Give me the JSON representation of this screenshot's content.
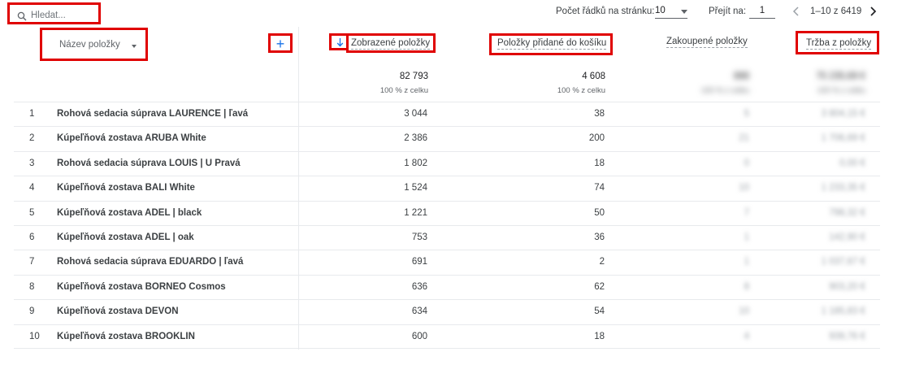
{
  "search": {
    "placeholder": "Hledat..."
  },
  "pager": {
    "rows_label": "Počet řádků na stránku:",
    "rows_value": "10",
    "goto_label": "Přejít na:",
    "goto_value": "1",
    "range": "1–10 z 6419"
  },
  "columns": {
    "dimension": "Název položky",
    "views": "Zobrazené položky",
    "cart": "Položky přidané do košíku",
    "purchased": "Zakoupené položky",
    "revenue": "Tržba z položky"
  },
  "totals": {
    "views": "82 793",
    "views_pct": "100 % z celku",
    "cart": "4 608",
    "cart_pct": "100 % z celku",
    "purchased": "888",
    "purchased_pct": "100 % z celku",
    "revenue": "75 235,69 €",
    "revenue_pct": "100 % z celku"
  },
  "rows": [
    {
      "idx": "1",
      "name": "Rohová sedacia súprava LAURENCE | ľavá",
      "views": "3 044",
      "cart": "38",
      "purchased": "5",
      "revenue": "3 804,15 €"
    },
    {
      "idx": "2",
      "name": "Kúpeľňová zostava ARUBA White",
      "views": "2 386",
      "cart": "200",
      "purchased": "21",
      "revenue": "1 706,69 €"
    },
    {
      "idx": "3",
      "name": "Rohová sedacia súprava LOUIS | U Pravá",
      "views": "1 802",
      "cart": "18",
      "purchased": "0",
      "revenue": "0,00 €"
    },
    {
      "idx": "4",
      "name": "Kúpeľňová zostava BALI White",
      "views": "1 524",
      "cart": "74",
      "purchased": "10",
      "revenue": "1 233,35 €"
    },
    {
      "idx": "5",
      "name": "Kúpeľňová zostava ADEL | black",
      "views": "1 221",
      "cart": "50",
      "purchased": "7",
      "revenue": "798,32 €"
    },
    {
      "idx": "6",
      "name": "Kúpeľňová zostava ADEL | oak",
      "views": "753",
      "cart": "36",
      "purchased": "1",
      "revenue": "142,90 €"
    },
    {
      "idx": "7",
      "name": "Rohová sedacia súprava EDUARDO | ľavá",
      "views": "691",
      "cart": "2",
      "purchased": "1",
      "revenue": "1 037,67 €"
    },
    {
      "idx": "8",
      "name": "Kúpeľňová zostava BORNEO Cosmos",
      "views": "636",
      "cart": "62",
      "purchased": "8",
      "revenue": "903,20 €"
    },
    {
      "idx": "9",
      "name": "Kúpeľňová zostava DEVON",
      "views": "634",
      "cart": "54",
      "purchased": "10",
      "revenue": "1 185,83 €"
    },
    {
      "idx": "10",
      "name": "Kúpeľňová zostava BROOKLIN",
      "views": "600",
      "cart": "18",
      "purchased": "4",
      "revenue": "939,76 €"
    }
  ],
  "colors": {
    "highlight": "#e00000",
    "accent": "#1a73e8",
    "grid": "#e8eaed"
  },
  "icons": {
    "search": "search-icon",
    "add": "plus-icon",
    "sort": "arrow-down-icon"
  }
}
